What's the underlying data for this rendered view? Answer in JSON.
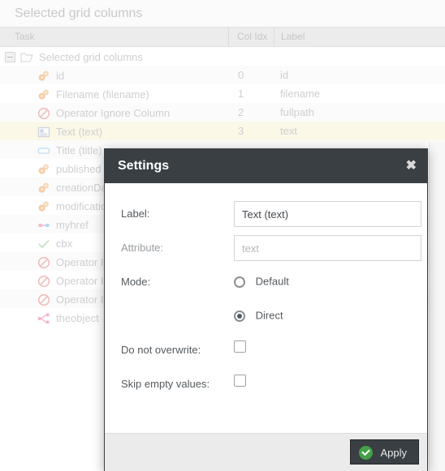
{
  "panel": {
    "title": "Selected grid columns"
  },
  "grid": {
    "columns": [
      "Task",
      "Col Idx",
      "Label"
    ],
    "rows": [
      {
        "task": "Selected grid columns",
        "colidx": "",
        "label": "",
        "icon": "folder-icon",
        "level": 0,
        "expander": true,
        "selected": false
      },
      {
        "task": "id",
        "colidx": "0",
        "label": "id",
        "icon": "gears-icon",
        "level": 1,
        "expander": false,
        "selected": false
      },
      {
        "task": "Filename (filename)",
        "colidx": "1",
        "label": "filename",
        "icon": "gears-icon",
        "level": 1,
        "expander": false,
        "selected": false
      },
      {
        "task": "Operator Ignore Column",
        "colidx": "2",
        "label": "fullpath",
        "icon": "ignore-icon",
        "level": 1,
        "expander": false,
        "selected": false
      },
      {
        "task": "Text (text)",
        "colidx": "3",
        "label": "text",
        "icon": "text-field-icon",
        "level": 1,
        "expander": false,
        "selected": true
      },
      {
        "task": "Title (title)",
        "colidx": "",
        "label": "",
        "icon": "textbox-icon",
        "level": 1,
        "expander": false,
        "selected": false
      },
      {
        "task": "published",
        "colidx": "",
        "label": "",
        "icon": "gears-icon",
        "level": 1,
        "expander": false,
        "selected": false
      },
      {
        "task": "creationDate",
        "colidx": "",
        "label": "",
        "icon": "gears-icon",
        "level": 1,
        "expander": false,
        "selected": false
      },
      {
        "task": "modificationDate",
        "colidx": "",
        "label": "",
        "icon": "gears-icon",
        "level": 1,
        "expander": false,
        "selected": false
      },
      {
        "task": "myhref",
        "colidx": "",
        "label": "",
        "icon": "link-icon",
        "level": 1,
        "expander": false,
        "selected": false
      },
      {
        "task": "cbx",
        "colidx": "",
        "label": "",
        "icon": "checkmark-icon",
        "level": 1,
        "expander": false,
        "selected": false
      },
      {
        "task": "Operator Ignore Column",
        "colidx": "",
        "label": "",
        "icon": "ignore-icon",
        "level": 1,
        "expander": false,
        "selected": false
      },
      {
        "task": "Operator Ignore Column",
        "colidx": "",
        "label": "",
        "icon": "ignore-icon",
        "level": 1,
        "expander": false,
        "selected": false
      },
      {
        "task": "Operator Ignore Column",
        "colidx": "",
        "label": "",
        "icon": "ignore-icon",
        "level": 1,
        "expander": false,
        "selected": false
      },
      {
        "task": "theobject",
        "colidx": "",
        "label": "",
        "icon": "object-relation-icon",
        "level": 1,
        "expander": false,
        "selected": false
      }
    ]
  },
  "dialog": {
    "title": "Settings",
    "close_glyph": "✖",
    "fields": {
      "label_caption": "Label:",
      "label_value": "Text (text)",
      "attribute_caption": "Attribute:",
      "attribute_value": "",
      "attribute_placeholder": "text",
      "mode_caption": "Mode:",
      "mode_default": "Default",
      "mode_direct": "Direct",
      "mode_selected": "Direct",
      "do_not_overwrite_caption": "Do not overwrite:",
      "do_not_overwrite_checked": false,
      "skip_empty_caption": "Skip empty values:",
      "skip_empty_checked": false
    },
    "footer": {
      "apply_label": "Apply"
    }
  },
  "colors": {
    "header_bg": "#3a3f44",
    "accent_green": "#43a047",
    "selected_row": "#fbf8e8"
  }
}
